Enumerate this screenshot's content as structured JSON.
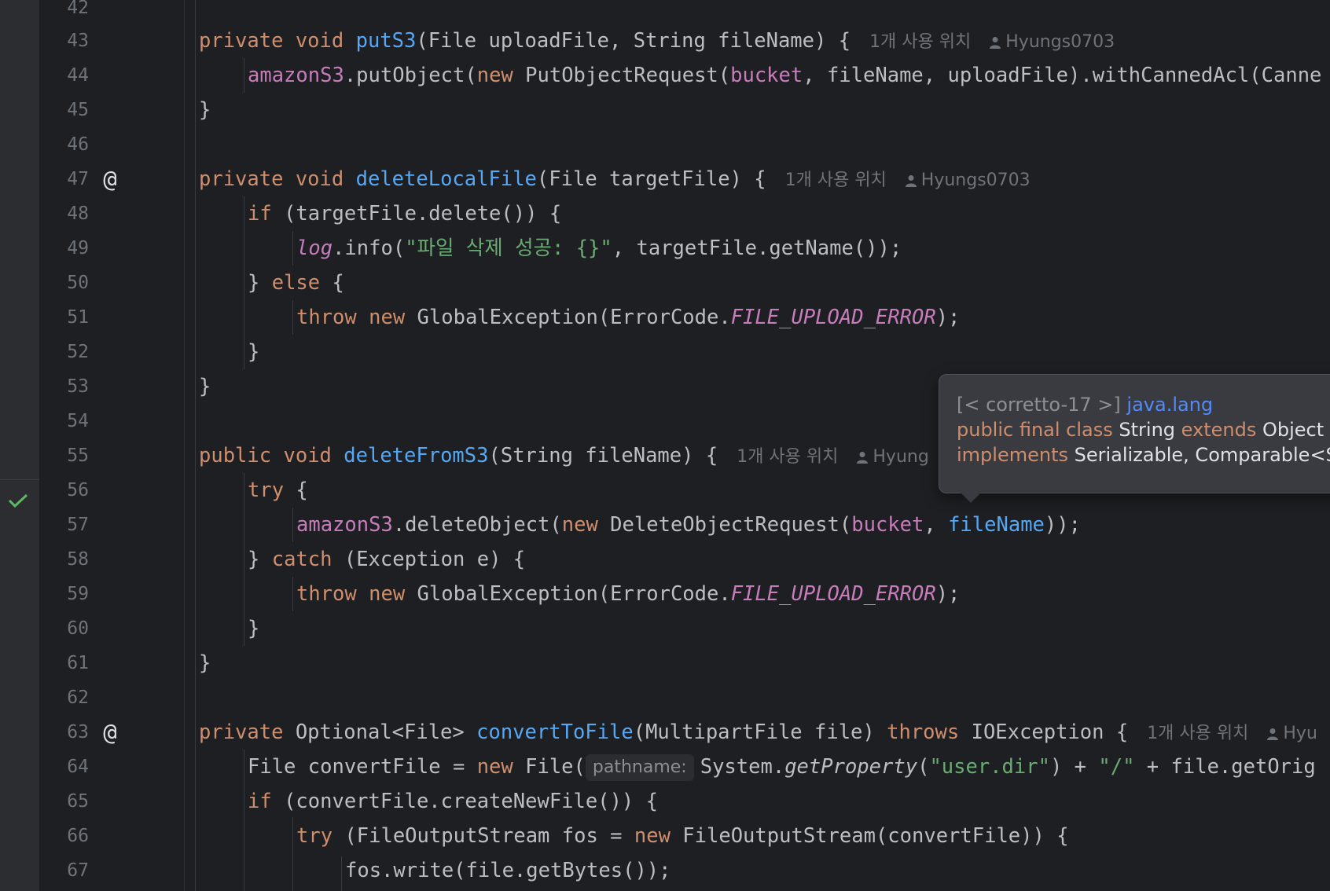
{
  "colors": {
    "background": "#1e1f22",
    "keyword": "#cf8e6d",
    "method_declaration": "#56a8f5",
    "field": "#c77dbb",
    "string": "#6aab73",
    "line_number": "#6f737a",
    "inlay_hint": "#6f737a",
    "tooltip_background": "#393b40",
    "vcs_check": "#5fb865"
  },
  "icons": {
    "check": "check-icon",
    "implementing_method_marker": "at-sign-icon",
    "author": "user-icon"
  },
  "lines": {
    "n42": "42",
    "n43": "43",
    "n44": "44",
    "n45": "45",
    "n46": "46",
    "n47": "47",
    "n48": "48",
    "n49": "49",
    "n50": "50",
    "n51": "51",
    "n52": "52",
    "n53": "53",
    "n54": "54",
    "n55": "55",
    "n56": "56",
    "n57": "57",
    "n58": "58",
    "n59": "59",
    "n60": "60",
    "n61": "61",
    "n62": "62",
    "n63": "63",
    "n64": "64",
    "n65": "65",
    "n66": "66",
    "n67": "67"
  },
  "gutter": {
    "at_marker": "@"
  },
  "tokens": {
    "private": "private",
    "public": "public",
    "void": "void",
    "new": "new",
    "if": "if",
    "else": "else",
    "throw": "throw",
    "try": "try",
    "catch": "catch",
    "throws": "throws",
    "close_brace": "}",
    "l43_name": "putS3",
    "l43_params": "(File uploadFile, String fileName) {",
    "l44_field": "amazonS3",
    "l44_a": ".putObject(",
    "l44_b": " PutObjectRequest(",
    "l44_bucket": "bucket",
    "l44_c": ", fileName, uploadFile).withCannedAcl(Canne",
    "l47_name": "deleteLocalFile",
    "l47_params": "(File targetFile) {",
    "l48_rest": " (targetFile.delete()) {",
    "l49_log": "log",
    "l49_a": ".info(",
    "l49_str": "\"파일 삭제 성공: {}\"",
    "l49_b": ", targetFile.getName());",
    "l50_a": "} ",
    "l50_b": " {",
    "l51_a": " GlobalException(ErrorCode.",
    "l51_const": "FILE_UPLOAD_ERROR",
    "l51_b": ");",
    "l55_name": "deleteFromS3",
    "l55_params": "(String fileName) {",
    "l55_author": "Hyung",
    "l56_rest": " {",
    "l57_field": "amazonS3",
    "l57_a": ".deleteObject(",
    "l57_b": " DeleteObjectRequest(",
    "l57_bucket": "bucket",
    "l57_c": ", ",
    "l57_param": "fileName",
    "l57_d": "));",
    "l58_a": "} ",
    "l58_b": " (Exception e) {",
    "l63_type": "Optional<File>",
    "l63_name": "convertToFile",
    "l63_params": "(MultipartFile file) ",
    "l63_exc": " IOException {",
    "l63_author": "Hyu",
    "l64_a": "File convertFile = ",
    "l64_b": " File(",
    "l64_hint": "pathname:",
    "l64_c": "System.",
    "l64_method": "getProperty",
    "l64_d": "(",
    "l64_str1": "\"user.dir\"",
    "l64_e": ") + ",
    "l64_str2": "\"/\"",
    "l64_f": " + file.getOrig",
    "l65_rest": " (convertFile.createNewFile()) {",
    "l66_a": " (FileOutputStream fos = ",
    "l66_b": " FileOutputStream(convertFile)) {",
    "l67_code": "fos.write(file.getBytes());"
  },
  "inlay": {
    "usages": "1개 사용 위치",
    "author": "Hyungs0703"
  },
  "tooltip": {
    "sdk": "[< corretto-17 >]",
    "package": "java.lang",
    "l2_mods": "public final class",
    "l2_name": "String",
    "l2_extends": "extends",
    "l2_object": "Object",
    "l3_implements": "implements",
    "l3_rest": "Serializable, Comparable<S"
  }
}
